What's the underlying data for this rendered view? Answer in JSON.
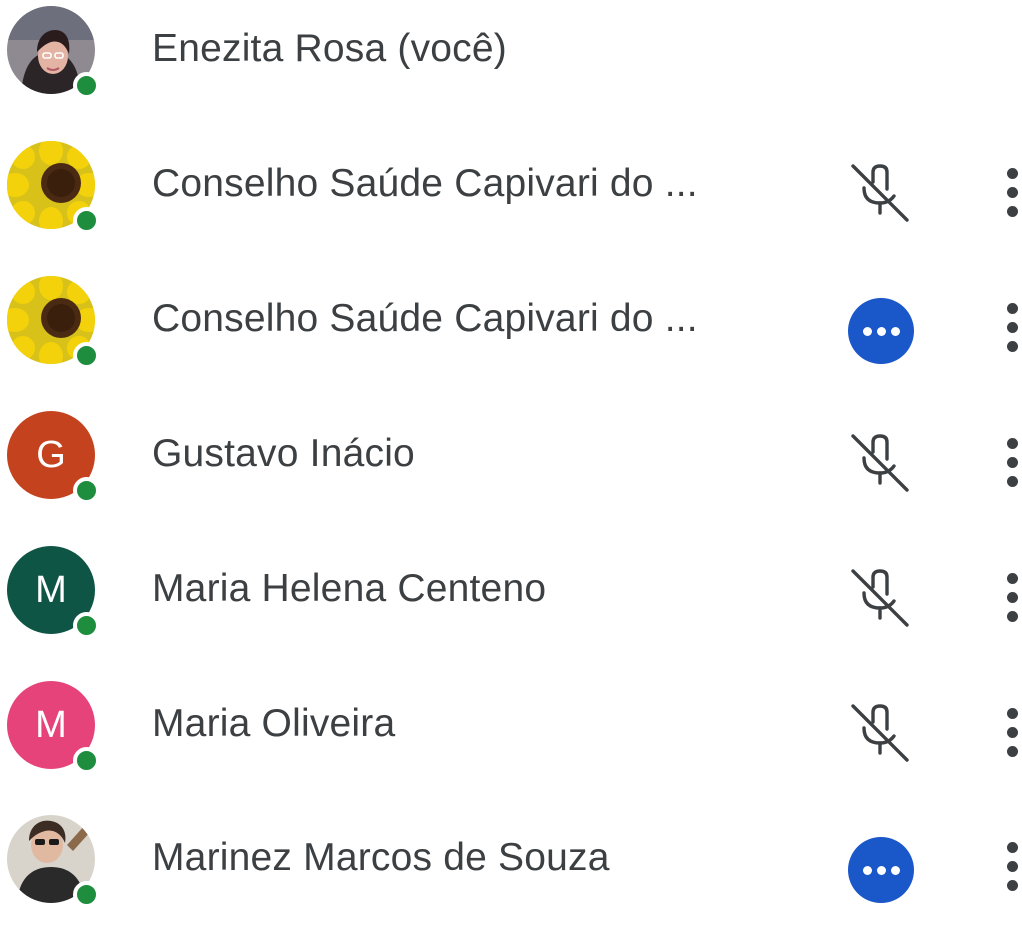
{
  "participants": [
    {
      "name": "Enezita Rosa (você)",
      "avatar": {
        "type": "photo",
        "icon": "person-photo-woman"
      },
      "presence": "online",
      "status": "none",
      "menu": false
    },
    {
      "name": "Conselho Saúde Capivari do ...",
      "avatar": {
        "type": "photo",
        "icon": "sunflower-photo"
      },
      "presence": "online",
      "status": "muted",
      "menu": true
    },
    {
      "name": "Conselho Saúde Capivari do ...",
      "avatar": {
        "type": "photo",
        "icon": "sunflower-photo"
      },
      "presence": "online",
      "status": "more",
      "menu": true
    },
    {
      "name": "Gustavo Inácio",
      "avatar": {
        "type": "initial",
        "letter": "G",
        "color": "#c4431e"
      },
      "presence": "online",
      "status": "muted",
      "menu": true
    },
    {
      "name": "Maria Helena Centeno",
      "avatar": {
        "type": "initial",
        "letter": "M",
        "color": "#0e5545"
      },
      "presence": "online",
      "status": "muted",
      "menu": true
    },
    {
      "name": "Maria Oliveira",
      "avatar": {
        "type": "initial",
        "letter": "M",
        "color": "#e5437a"
      },
      "presence": "online",
      "status": "muted",
      "menu": true
    },
    {
      "name": "Marinez Marcos de Souza",
      "avatar": {
        "type": "photo",
        "icon": "person-photo-sunglasses"
      },
      "presence": "online",
      "status": "more",
      "menu": true
    }
  ],
  "colors": {
    "presence_online": "#1e8e3e",
    "status_more_bg": "#1a57c9",
    "text": "#3c4043",
    "icon": "#3c4043"
  },
  "icons": {
    "muted": "mic-off-icon",
    "more": "more-horiz-icon",
    "menu": "more-vert-icon",
    "presence": "online-dot-icon"
  }
}
